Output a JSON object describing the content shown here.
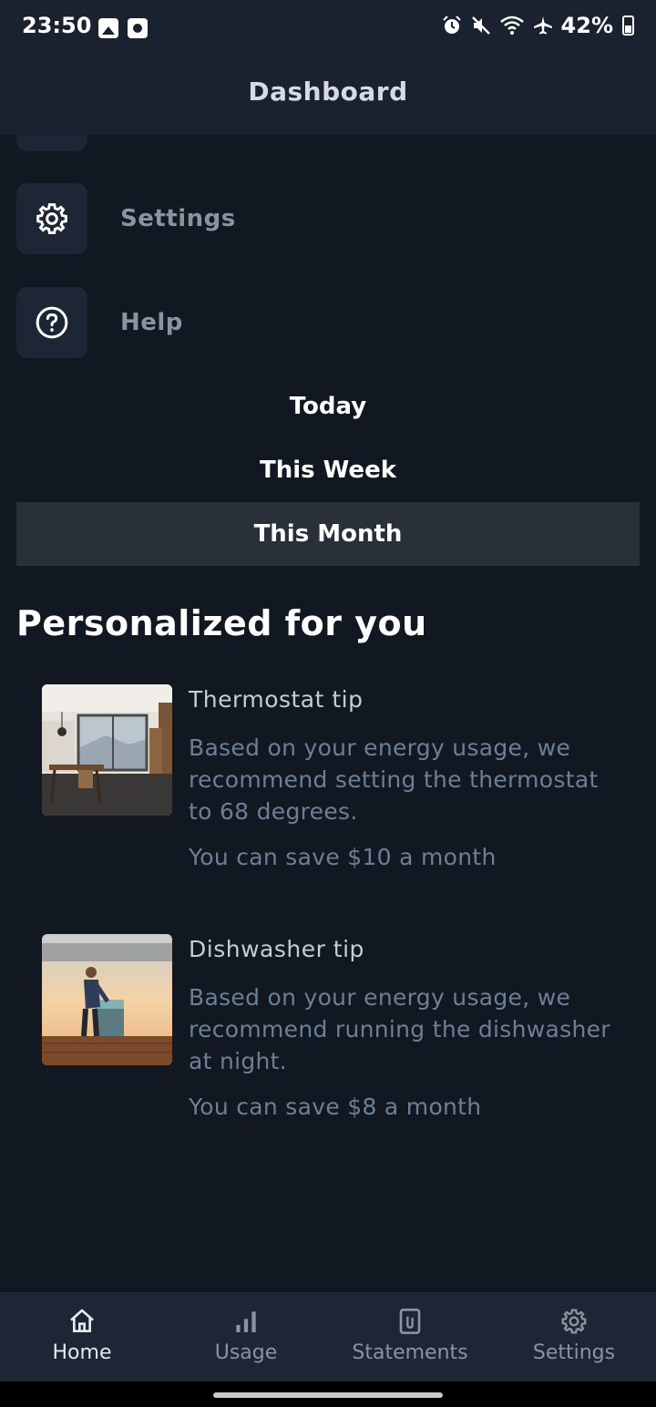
{
  "status_bar": {
    "time": "23:50",
    "battery": "42%"
  },
  "app_bar": {
    "title": "Dashboard"
  },
  "menu": {
    "items": [
      {
        "label": "Settings",
        "icon": "gear-icon"
      },
      {
        "label": "Help",
        "icon": "help-circle-icon"
      }
    ]
  },
  "period_selector": {
    "options": [
      "Today",
      "This Week",
      "This Month"
    ],
    "selected": "This Month"
  },
  "personalized": {
    "title": "Personalized for you",
    "tips": [
      {
        "title": "Thermostat tip",
        "body": "Based on your energy usage, we recommend setting the thermostat to 68 degrees.",
        "savings": "You can save $10 a month",
        "image": "modern-interior-room"
      },
      {
        "title": "Dishwasher tip",
        "body": "Based on your energy usage, we recommend running the dishwasher at night.",
        "savings": "You can save $8 a month",
        "image": "person-at-appliance"
      }
    ]
  },
  "bottom_nav": {
    "items": [
      {
        "label": "Home",
        "icon": "home-icon",
        "active": true
      },
      {
        "label": "Usage",
        "icon": "bar-chart-icon",
        "active": false
      },
      {
        "label": "Statements",
        "icon": "document-icon",
        "active": false
      },
      {
        "label": "Settings",
        "icon": "gear-icon",
        "active": false
      }
    ]
  },
  "colors": {
    "background": "#121822",
    "app_bar": "#1a2230",
    "tile": "#1c2634",
    "selected_period": "#2a303a",
    "muted_text": "#6c7f95"
  }
}
